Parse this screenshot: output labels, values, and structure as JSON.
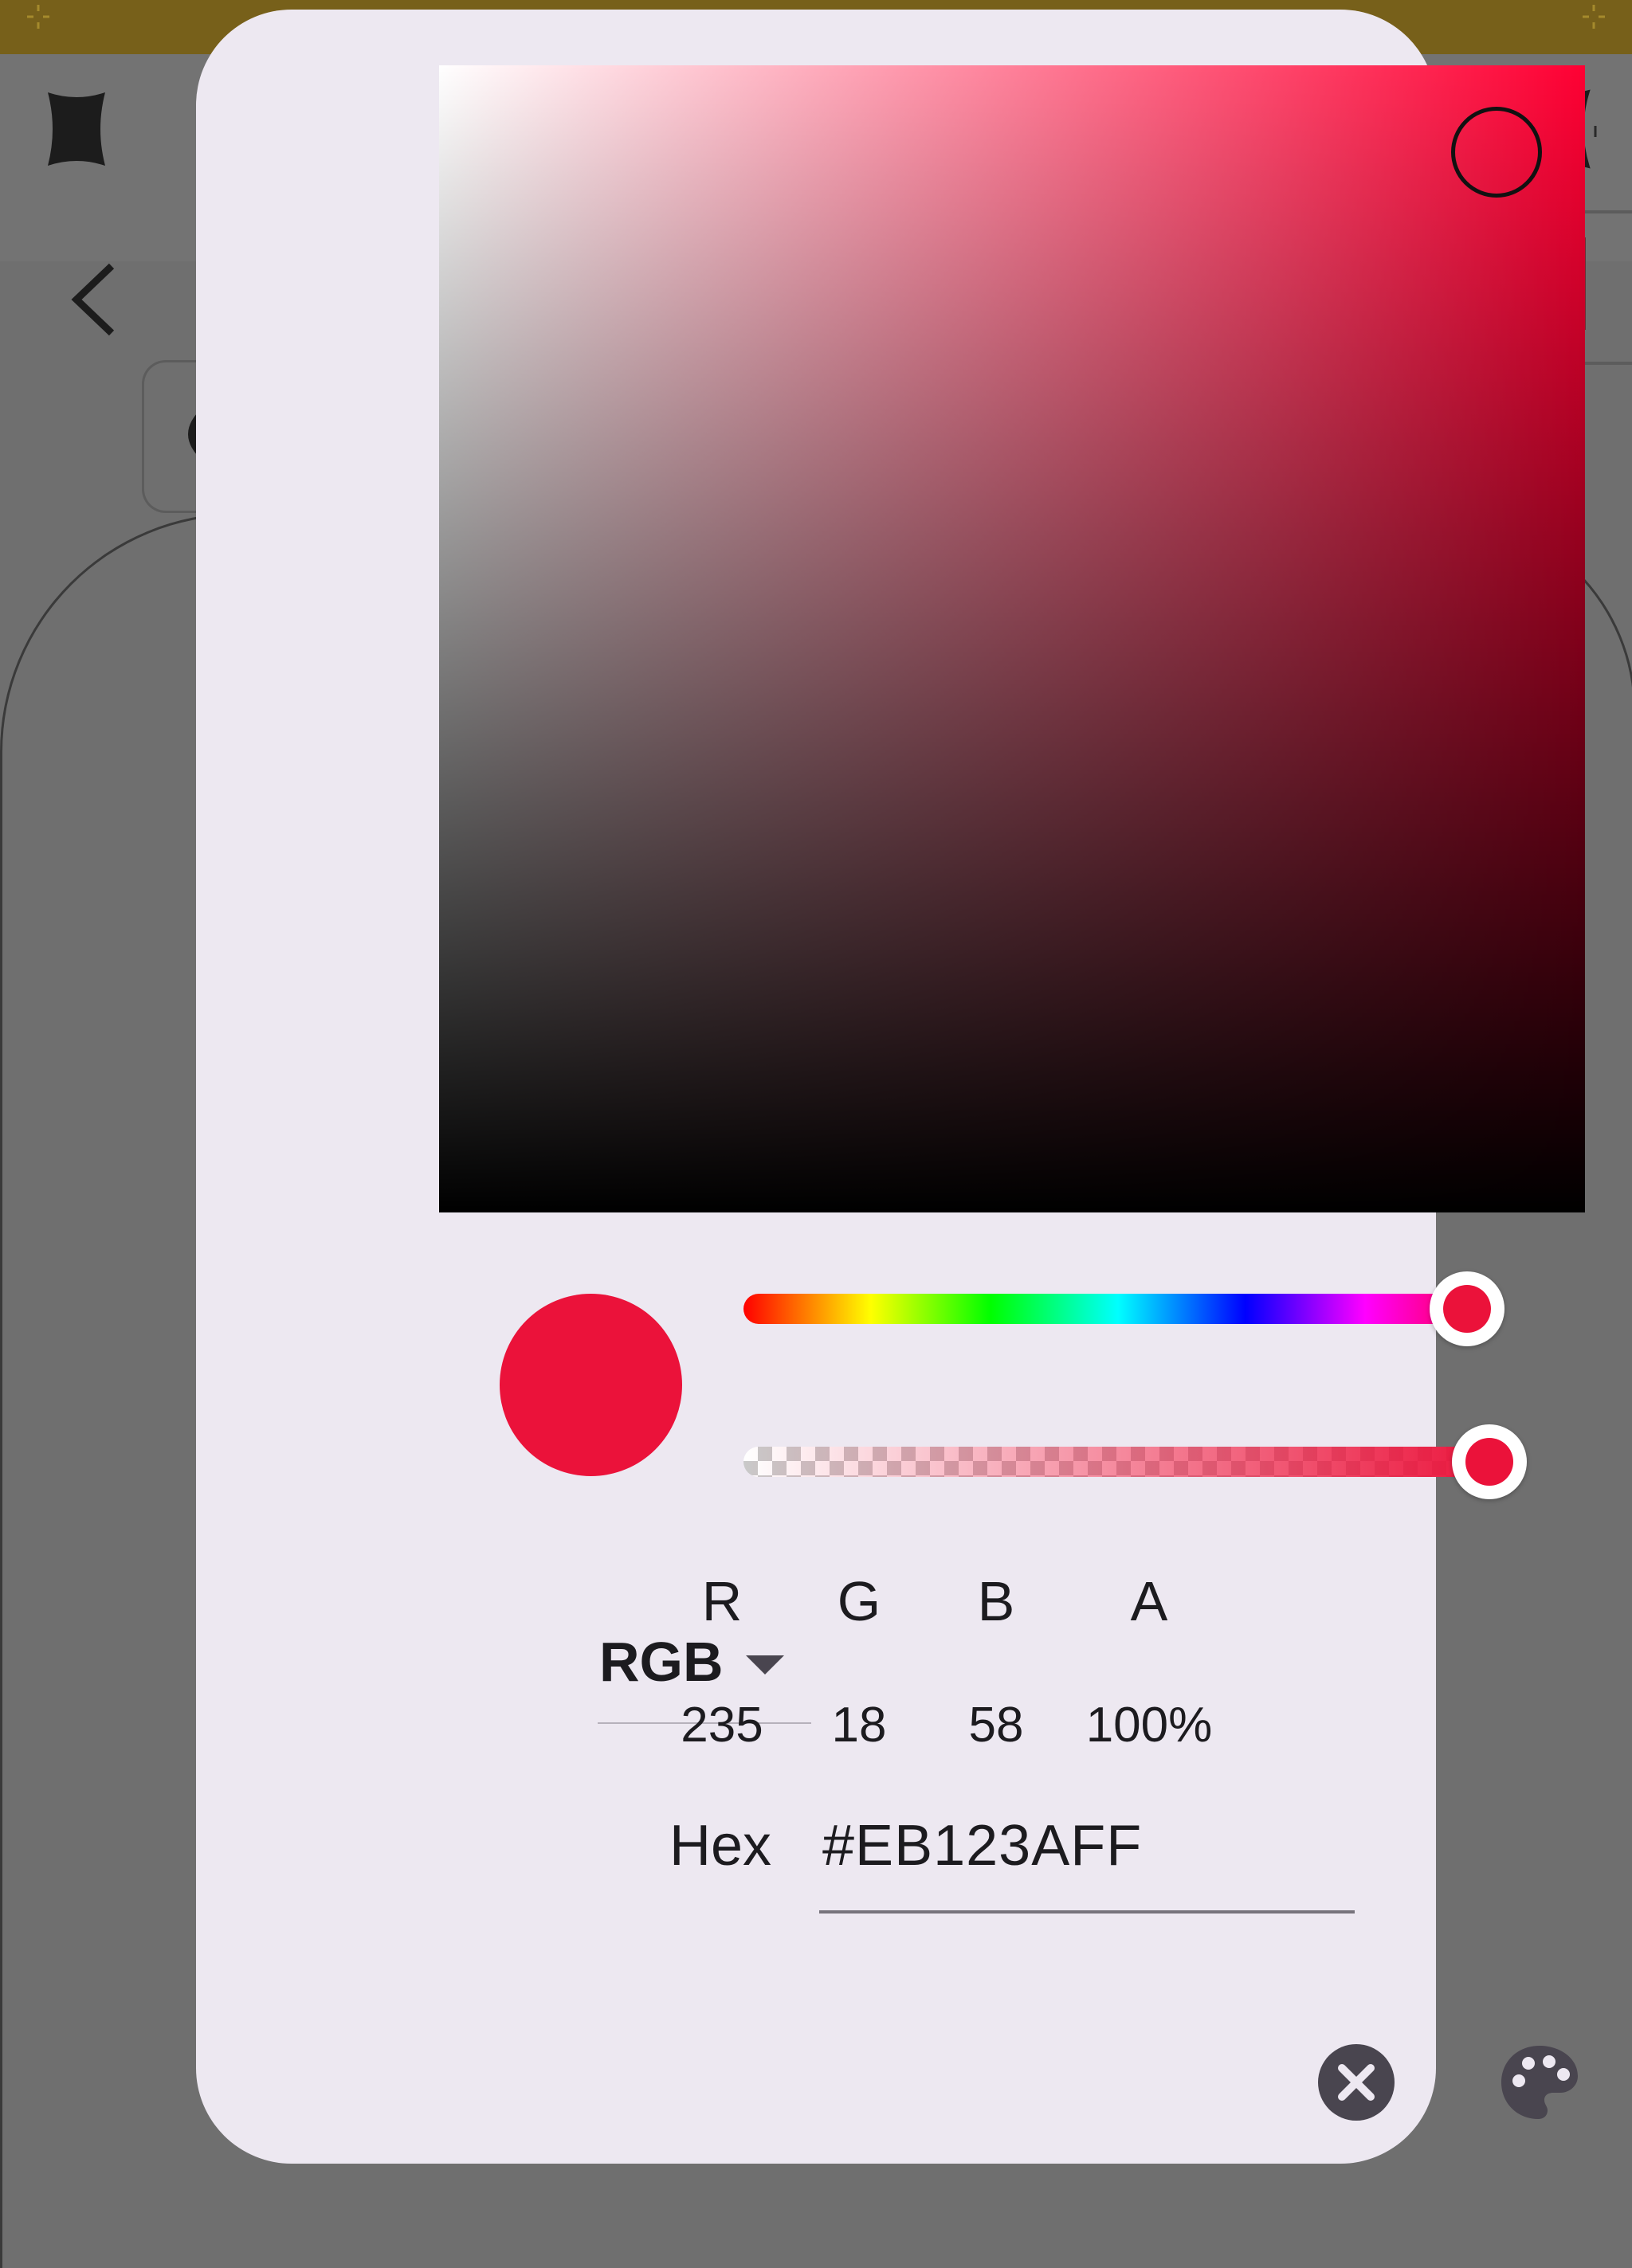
{
  "background_app": {
    "status_bar_color": "#77601a",
    "scrim_color": "#6f6f6f",
    "icons": [
      "barrel-distortion-icon",
      "back-chevron-icon",
      "pincushion-distortion-icon",
      "eye-icon"
    ],
    "selected_swatch_color": "#6a3039"
  },
  "color_picker": {
    "current_color": "#eb123a",
    "picker_square_hue_color": "#ff0033",
    "hue_position": 1.0,
    "alpha_position": 1.0,
    "mode": {
      "label": "RGB"
    },
    "channels": [
      {
        "label": "R",
        "value": "235"
      },
      {
        "label": "G",
        "value": "18"
      },
      {
        "label": "B",
        "value": "58"
      },
      {
        "label": "A",
        "value": "100%"
      }
    ],
    "hex": {
      "label": "Hex",
      "value": "#EB123AFF"
    },
    "actions": {
      "cancel_icon": "close-circle-icon",
      "palette_icon": "palette-icon",
      "icon_color": "#49454f"
    }
  }
}
